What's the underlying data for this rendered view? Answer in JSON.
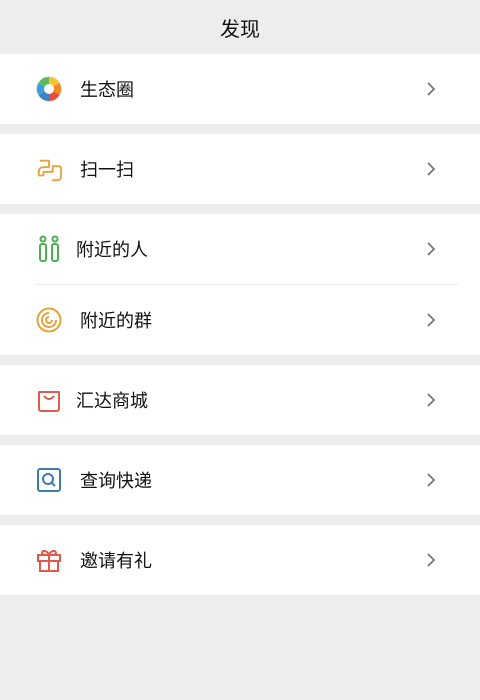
{
  "header": {
    "title": "发现"
  },
  "menu": {
    "moments": {
      "label": "生态圈",
      "icon": "aperture-icon"
    },
    "scan": {
      "label": "扫一扫",
      "icon": "scan-icon"
    },
    "people_nearby": {
      "label": "附近的人",
      "icon": "people-icon"
    },
    "groups_nearby": {
      "label": "附近的群",
      "icon": "radar-icon"
    },
    "mall": {
      "label": "汇达商城",
      "icon": "shopping-bag-icon"
    },
    "express": {
      "label": "查询快递",
      "icon": "search-box-icon"
    },
    "invite": {
      "label": "邀请有礼",
      "icon": "gift-icon"
    }
  },
  "colors": {
    "background": "#ededed",
    "card": "#ffffff",
    "text": "#111111",
    "chevron": "#777777",
    "scan": "#e3a43a",
    "people": "#4caf50",
    "radar": "#e3a43a",
    "mall": "#e05a4e",
    "express": "#3e7bb0",
    "gift": "#e05a4e"
  }
}
